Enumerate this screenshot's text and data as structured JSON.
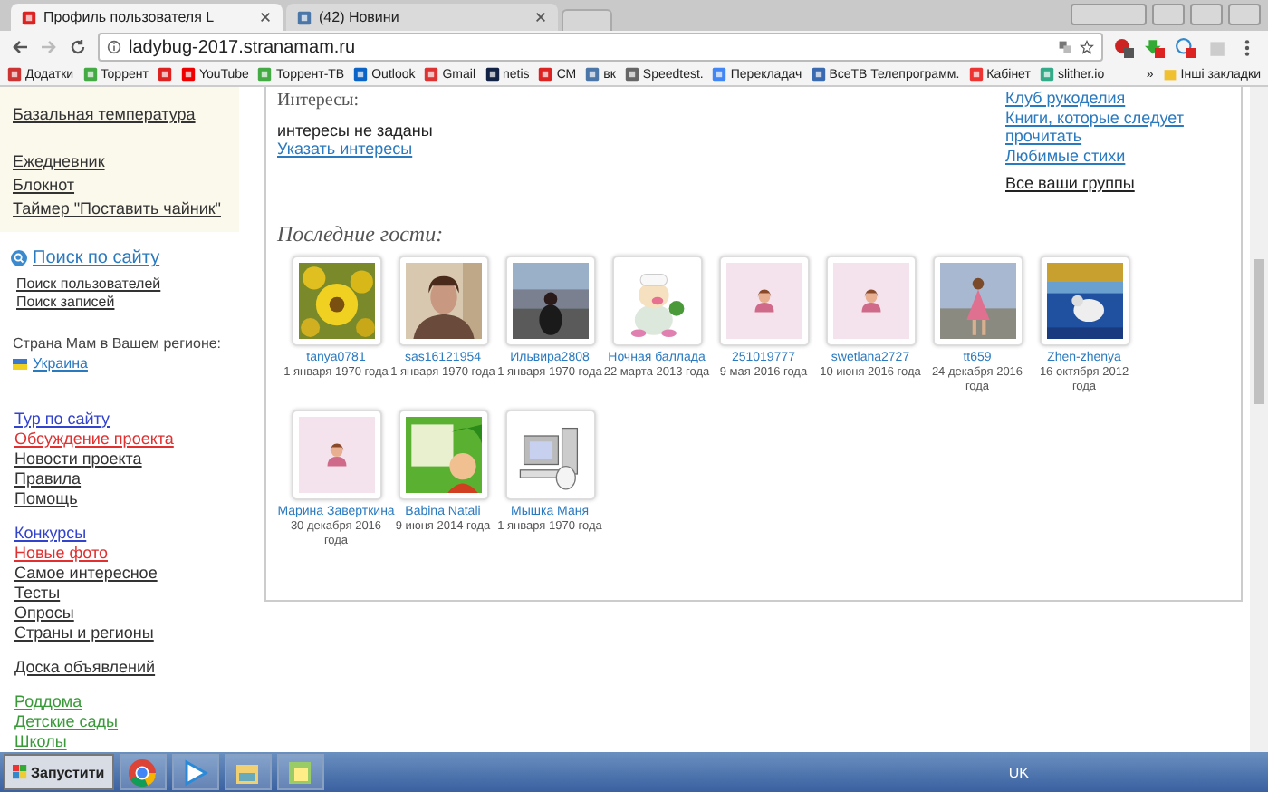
{
  "browser": {
    "tabs": [
      {
        "title": "Профиль пользователя L",
        "selected": true
      },
      {
        "title": "(42) Новини",
        "selected": false
      }
    ],
    "address": "ladybug-2017.stranamam.ru",
    "bookmarks": [
      {
        "kind": "labeled",
        "label": "Додатки"
      },
      {
        "kind": "labeled",
        "label": "Торрент"
      },
      {
        "kind": "icon"
      },
      {
        "kind": "labeled",
        "label": "YouTube"
      },
      {
        "kind": "labeled",
        "label": "Торрент-ТВ"
      },
      {
        "kind": "labeled",
        "label": "Outlook"
      },
      {
        "kind": "labeled",
        "label": "Gmail"
      },
      {
        "kind": "labeled",
        "label": "netis"
      },
      {
        "kind": "labeled",
        "label": "СМ"
      },
      {
        "kind": "labeled",
        "label": "вк"
      },
      {
        "kind": "labeled",
        "label": "Speedtest."
      },
      {
        "kind": "labeled",
        "label": "Перекладач"
      },
      {
        "kind": "labeled",
        "label": "ВсеТВ Телепрограмм."
      },
      {
        "kind": "labeled",
        "label": "Кабінет"
      },
      {
        "kind": "labeled",
        "label": "slither.io"
      }
    ],
    "more": "»",
    "other_bookmarks": "Інші закладки"
  },
  "sidebar": {
    "tools": [
      "Базальная температура",
      "Ежедневник",
      "Блокнот",
      "Таймер \"Поставить чайник\""
    ],
    "search": {
      "title": "Поиск по сайту",
      "links": [
        "Поиск пользователей",
        "Поиск записей"
      ]
    },
    "region": {
      "label": "Страна Мам в Вашем регионе:",
      "country": "Украина"
    },
    "groups": [
      [
        {
          "label": "Тур по сайту",
          "color": "#3344cc"
        },
        {
          "label": "Обсуждение проекта",
          "color": "#e03030"
        },
        {
          "label": "Новости проекта",
          "color": "#333333"
        },
        {
          "label": "Правила",
          "color": "#333333"
        },
        {
          "label": "Помощь",
          "color": "#333333"
        }
      ],
      [
        {
          "label": "Конкурсы",
          "color": "#3344cc"
        },
        {
          "label": "Новые фото",
          "color": "#e03030"
        },
        {
          "label": "Самое интересное",
          "color": "#333333"
        },
        {
          "label": "Тесты",
          "color": "#333333"
        },
        {
          "label": "Опросы",
          "color": "#333333"
        },
        {
          "label": "Страны и регионы",
          "color": "#333333"
        }
      ],
      [
        {
          "label": "Доска объявлений",
          "color": "#333333"
        }
      ],
      [
        {
          "label": "Роддома",
          "color": "#3a9a3a"
        },
        {
          "label": "Детские сады",
          "color": "#3a9a3a"
        },
        {
          "label": "Школы",
          "color": "#3a9a3a"
        }
      ]
    ]
  },
  "main": {
    "interests": {
      "heading": "Интересы:",
      "text": "интересы не заданы",
      "link": "Указать интересы"
    },
    "clubs": [
      {
        "label": "Клуб рукоделия",
        "kind": "club"
      },
      {
        "label": "Книги, которые следует прочитать",
        "kind": "club"
      },
      {
        "label": "Любимые стихи",
        "kind": "club"
      },
      {
        "label": "Все ваши группы",
        "kind": "all"
      }
    ],
    "guests": {
      "heading": "Последние гости:",
      "items": [
        {
          "name": "tanya0781",
          "date": "1 января 1970 года"
        },
        {
          "name": "sas16121954",
          "date": "1 января 1970 года"
        },
        {
          "name": "Ильвира2808",
          "date": "1 января 1970 года"
        },
        {
          "name": "Ночная баллада",
          "date": "22 марта 2013 года"
        },
        {
          "name": "251019777",
          "date": "9 мая 2016 года"
        },
        {
          "name": "swetlana2727",
          "date": "10 июня 2016 года"
        },
        {
          "name": "tt659",
          "date": "24 декабря 2016 года"
        },
        {
          "name": "Zhen-zhenya",
          "date": "16 октября 2012 года"
        },
        {
          "name": "Марина Заверткина",
          "date": "30 декабря 2016 года"
        },
        {
          "name": "Babina Natali",
          "date": "9 июня 2014 года"
        },
        {
          "name": "Мышка Маня",
          "date": "1 января 1970 года"
        }
      ]
    }
  },
  "taskbar": {
    "start": "Запустити",
    "language": "UK"
  }
}
